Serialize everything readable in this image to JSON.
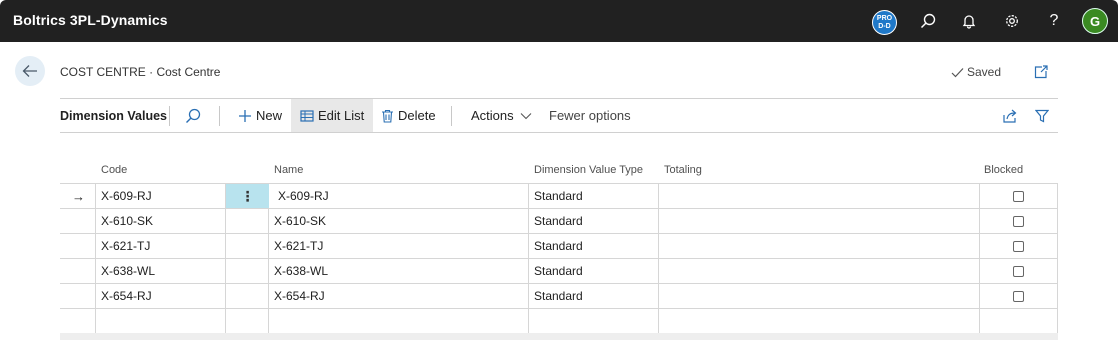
{
  "app": {
    "title": "Boltrics 3PL-Dynamics",
    "prod_badge_line1": "PRO",
    "prod_badge_line2": "D-D",
    "avatar_initial": "G"
  },
  "header": {
    "breadcrumb": "COST CENTRE · Cost Centre",
    "saved_label": "Saved"
  },
  "actionbar": {
    "title": "Dimension Values",
    "new_label": "New",
    "edit_list_label": "Edit List",
    "delete_label": "Delete",
    "actions_label": "Actions",
    "fewer_options_label": "Fewer options"
  },
  "grid": {
    "columns": {
      "code": "Code",
      "name": "Name",
      "type": "Dimension Value Type",
      "totaling": "Totaling",
      "blocked": "Blocked"
    },
    "rows": [
      {
        "code": "X-609-RJ",
        "name": "X-609-RJ",
        "type": "Standard",
        "totaling": "",
        "blocked": false
      },
      {
        "code": "X-610-SK",
        "name": "X-610-SK",
        "type": "Standard",
        "totaling": "",
        "blocked": false
      },
      {
        "code": "X-621-TJ",
        "name": "X-621-TJ",
        "type": "Standard",
        "totaling": "",
        "blocked": false
      },
      {
        "code": "X-638-WL",
        "name": "X-638-WL",
        "type": "Standard",
        "totaling": "",
        "blocked": false
      },
      {
        "code": "X-654-RJ",
        "name": "X-654-RJ",
        "type": "Standard",
        "totaling": "",
        "blocked": false
      }
    ],
    "current_row_indicator": "→",
    "row_menu_glyph": "⋮"
  },
  "colors": {
    "appbar": "#212121",
    "accent": "#1f78c8",
    "selected_cell": "#b8e3ee",
    "avatar": "#3a8a22"
  }
}
